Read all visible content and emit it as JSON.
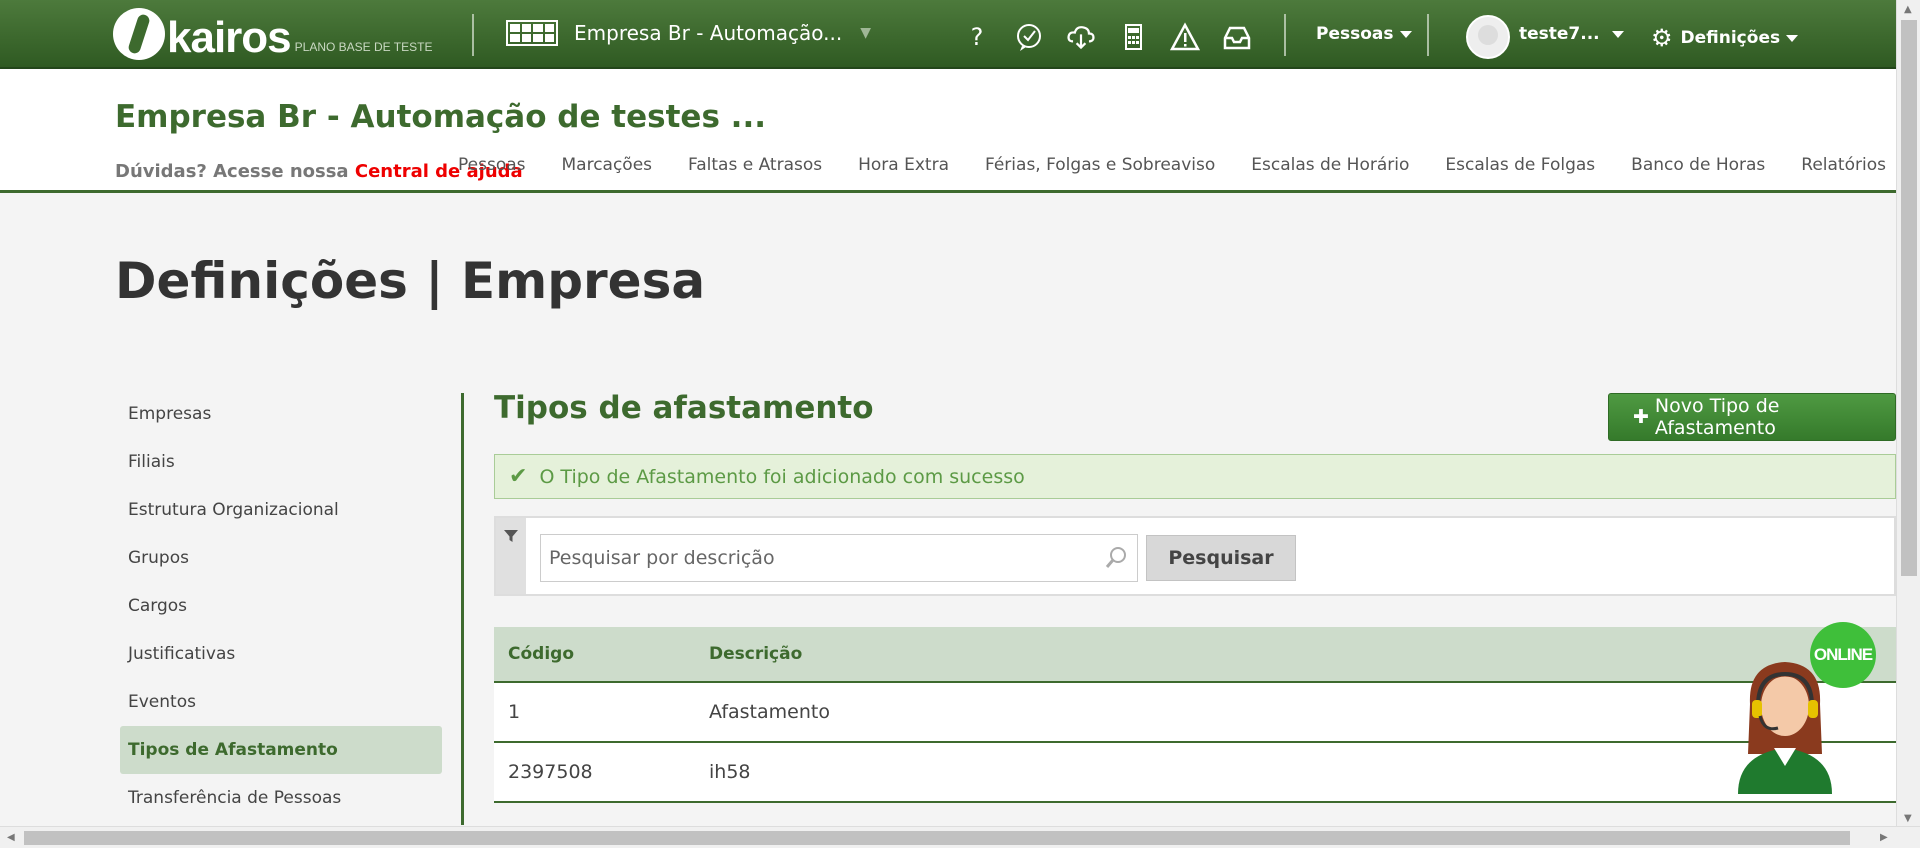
{
  "topbar": {
    "logo_text": "kairos",
    "logo_sub": "PLANO BASE DE TESTE",
    "company": "Empresa Br - Automação...",
    "people_menu": "Pessoas",
    "user_name": "teste7...",
    "settings_menu": "Definições"
  },
  "header": {
    "company_title": "Empresa Br - Automação de testes ...",
    "help_prefix": "Dúvidas? Acesse nossa",
    "help_link": "Central de ajuda",
    "nav": [
      "Pessoas",
      "Marcações",
      "Faltas e Atrasos",
      "Hora Extra",
      "Férias, Folgas e Sobreaviso",
      "Escalas de Horário",
      "Escalas de Folgas",
      "Banco de Horas",
      "Relatórios"
    ]
  },
  "page_title": "Definições | Empresa",
  "sidebar": {
    "items": [
      "Empresas",
      "Filiais",
      "Estrutura Organizacional",
      "Grupos",
      "Cargos",
      "Justificativas",
      "Eventos",
      "Tipos de Afastamento",
      "Transferência de Pessoas"
    ],
    "active_index": 7
  },
  "main": {
    "title": "Tipos de afastamento",
    "new_button": "Novo Tipo de Afastamento",
    "success_message": "O Tipo de Afastamento foi adicionado com sucesso",
    "search_placeholder": "Pesquisar por descrição",
    "search_button": "Pesquisar",
    "table": {
      "headers": [
        "Código",
        "Descrição"
      ],
      "rows": [
        [
          "1",
          "Afastamento"
        ],
        [
          "2397508",
          "ih58"
        ]
      ]
    }
  },
  "chat": {
    "badge": "ONLINE"
  },
  "colors": {
    "brand_green": "#3d6a2e",
    "accent_green": "#3fbf3a",
    "help_red": "#e00000"
  }
}
